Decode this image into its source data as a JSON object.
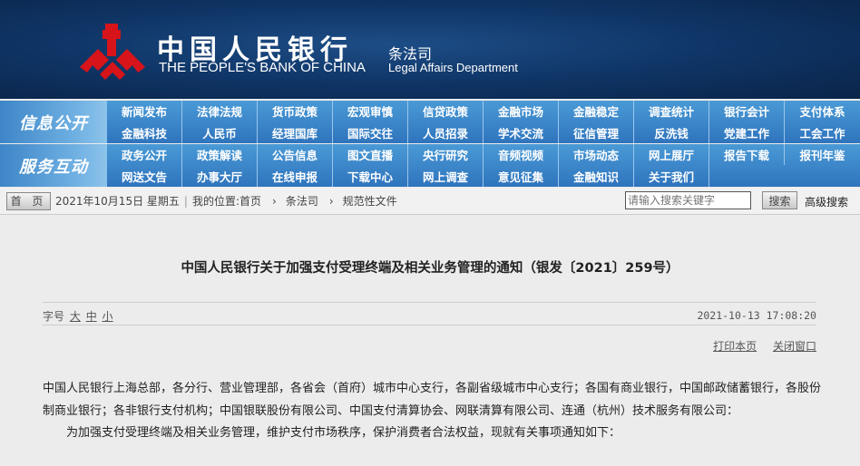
{
  "header": {
    "bank_cn": "中国人民银行",
    "bank_en": "THE PEOPLE'S BANK OF CHINA",
    "dept_cn": "条法司",
    "dept_en": "Legal Affairs Department",
    "logo_color": "#d7141a"
  },
  "nav": [
    {
      "label": "信息公开",
      "items": [
        "新闻发布",
        "法律法规",
        "货币政策",
        "宏观审慎",
        "信贷政策",
        "金融市场",
        "金融稳定",
        "调查统计",
        "银行会计",
        "支付体系",
        "金融科技",
        "人民币",
        "经理国库",
        "国际交往",
        "人员招录",
        "学术交流",
        "征信管理",
        "反洗钱",
        "党建工作",
        "工会工作"
      ]
    },
    {
      "label": "服务互动",
      "items": [
        "政务公开",
        "政策解读",
        "公告信息",
        "图文直播",
        "央行研究",
        "音频视频",
        "市场动态",
        "网上展厅",
        "报告下载",
        "报刊年鉴",
        "网送文告",
        "办事大厅",
        "在线申报",
        "下载中心",
        "网上调查",
        "意见征集",
        "金融知识",
        "关于我们"
      ]
    }
  ],
  "breadcrumb": {
    "home": "首 页",
    "date": "2021年10月15日  星期五",
    "location": "我的位置:首页",
    "items": [
      "条法司",
      "规范性文件"
    ],
    "search_placeholder": "请输入搜索关键字",
    "search_button": "搜索",
    "advanced": "高级搜索"
  },
  "article": {
    "title": "中国人民银行关于加强支付受理终端及相关业务管理的通知（银发〔2021〕259号）",
    "font_label": "字号",
    "font_sizes": [
      "大",
      "中",
      "小"
    ],
    "datetime": "2021-10-13 17:08:20",
    "print": "打印本页",
    "close": "关闭窗口",
    "paragraphs": [
      "中国人民银行上海总部，各分行、营业管理部，各省会（首府）城市中心支行，各副省级城市中心支行；各国有商业银行，中国邮政储蓄银行，各股份制商业银行；各非银行支付机构；中国银联股份有限公司、中国支付清算协会、网联清算有限公司、连通（杭州）技术服务有限公司：",
      "为加强支付受理终端及相关业务管理，维护支付市场秩序，保护消费者合法权益，现就有关事项通知如下："
    ]
  }
}
